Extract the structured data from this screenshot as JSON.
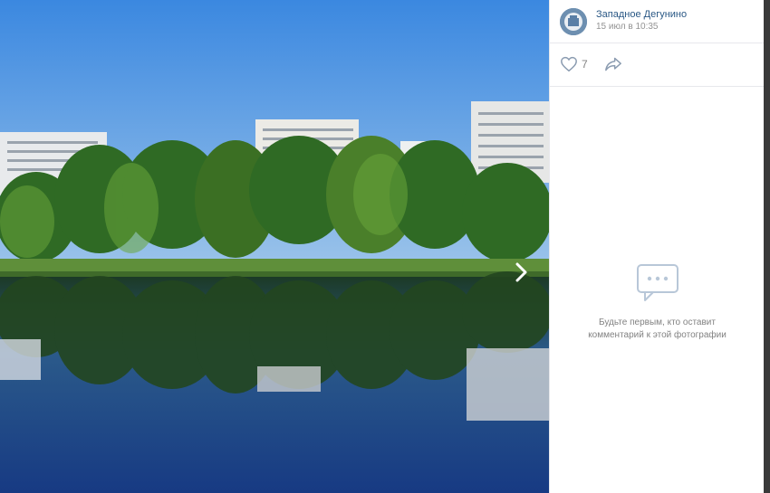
{
  "post": {
    "author": "Западное Дегунино",
    "date": "15 июл в 10:35"
  },
  "actions": {
    "likes": "7",
    "like_icon": "heart-icon",
    "share_icon": "share-icon"
  },
  "comments": {
    "empty_icon": "chat-bubble-icon",
    "empty_line1": "Будьте первым, кто оставит",
    "empty_line2": "комментарий к этой фотографии"
  },
  "photo": {
    "next_icon": "chevron-right-icon"
  },
  "colors": {
    "link": "#2a5885",
    "muted": "#828282",
    "divider": "#e7e8ec"
  }
}
